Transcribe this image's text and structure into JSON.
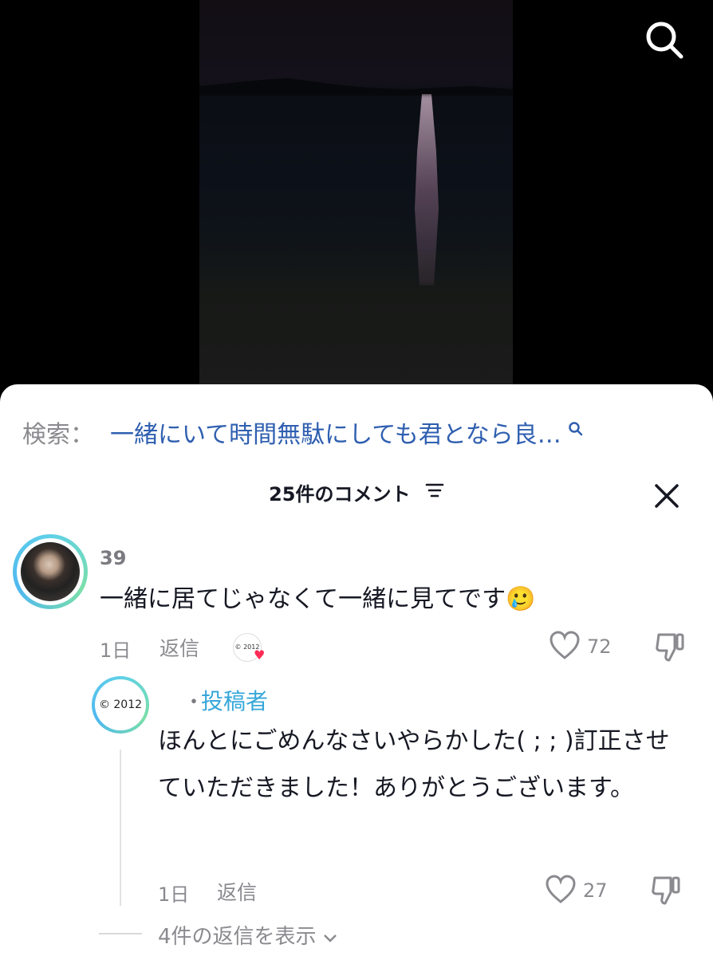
{
  "search": {
    "label": "検索：",
    "query": "一緒にいて時間無駄にしても君となら良…"
  },
  "comments_header": {
    "title": "25件のコメント"
  },
  "comments": [
    {
      "username": "39",
      "text": "一緒に居てじゃなくて一緒に見てです🥲",
      "age": "1日",
      "reply_label": "返信",
      "creator_liked_badge": "© 2012",
      "likes": "72"
    }
  ],
  "reply": {
    "avatar_text": "© 2012",
    "username_sep": "・",
    "creator_label": "投稿者",
    "text": "ほんとにごめんなさいやらかした( ; ; )訂正させていただきました！ありがとうございます。",
    "age": "1日",
    "reply_label": "返信",
    "likes": "27"
  },
  "view_replies": "4件の返信を表示",
  "icons": {
    "search": "search-icon",
    "filter": "filter-icon",
    "close": "close-icon",
    "like": "heart-outline-icon",
    "dislike": "thumbs-down-icon",
    "chevron": "chevron-down-icon"
  },
  "colors": {
    "search_query": "#2f5fb0",
    "creator_tag": "#36a7d9",
    "secondary_text": "#8a8a8f",
    "primary_text": "#161823",
    "heart_badge": "#fe2c55"
  }
}
